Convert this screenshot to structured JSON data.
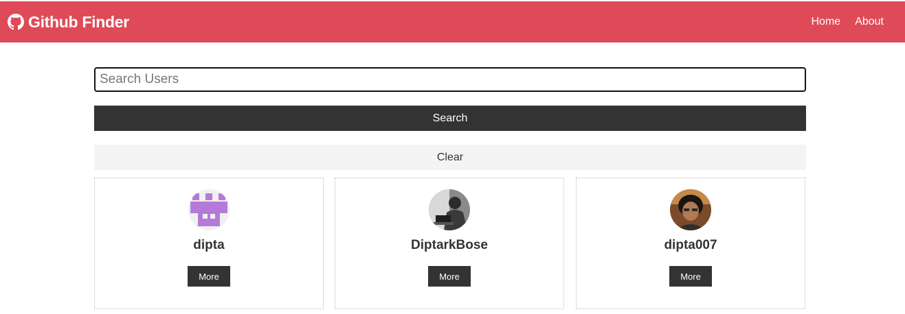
{
  "navbar": {
    "brand_icon": "github-icon",
    "title": "Github Finder",
    "links": [
      {
        "label": "Home"
      },
      {
        "label": "About"
      }
    ]
  },
  "search": {
    "placeholder": "Search Users",
    "value": "",
    "search_label": "Search",
    "clear_label": "Clear"
  },
  "users": [
    {
      "login": "dipta",
      "more_label": "More",
      "avatar": "identicon-avatar"
    },
    {
      "login": "DiptarkBose",
      "more_label": "More",
      "avatar": "photo-avatar"
    },
    {
      "login": "dipta007",
      "more_label": "More",
      "avatar": "photo-avatar"
    }
  ],
  "colors": {
    "navbar_bg": "#df4a58",
    "button_dark": "#333333",
    "button_light": "#f4f4f4",
    "identicon": "#b57ad9"
  }
}
